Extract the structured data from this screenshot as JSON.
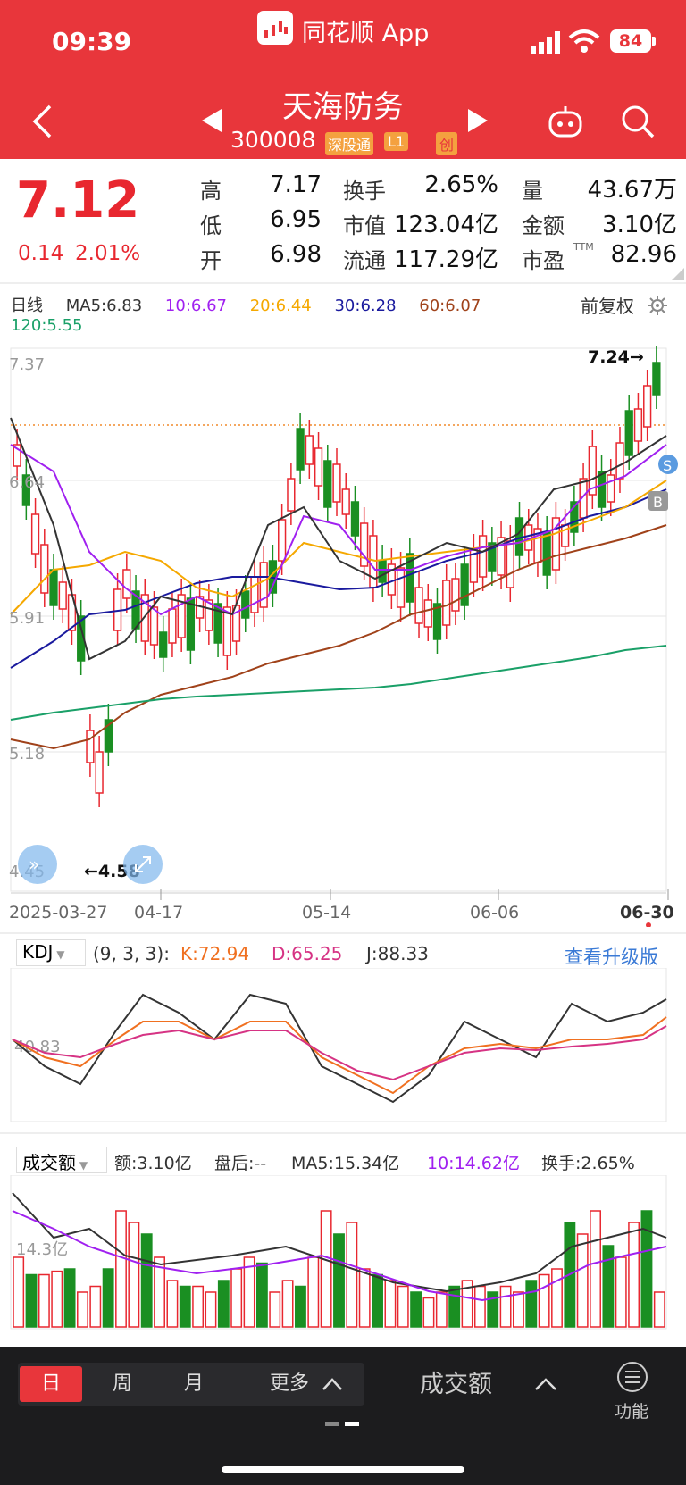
{
  "status": {
    "time": "09:39",
    "app_title": "同花顺 App",
    "battery": "84"
  },
  "stock": {
    "name": "天海防务",
    "code": "300008",
    "tag1": "深股通",
    "tag2": "L1",
    "tag3": "创"
  },
  "quote": {
    "price": "7.12",
    "change": "0.14",
    "pct": "2.01%",
    "high_label": "高",
    "high": "7.17",
    "low_label": "低",
    "low": "6.95",
    "open_label": "开",
    "open": "6.98",
    "turnover_label": "换手",
    "turnover": "2.65%",
    "mcap_label": "市值",
    "mcap": "123.04亿",
    "float_label": "流通",
    "float": "117.29亿",
    "vol_label": "量",
    "vol": "43.67万",
    "amount_label": "金额",
    "amount": "3.10亿",
    "pe_label": "市盈",
    "pe_sup": "TTM",
    "pe": "82.96"
  },
  "ma": {
    "period": "日线",
    "ma5": "MA5:6.83",
    "ma10": "10:6.67",
    "ma20": "20:6.44",
    "ma30": "30:6.28",
    "ma60": "60:6.07",
    "ma120": "120:5.55",
    "adjust": "前复权"
  },
  "chart": {
    "y_labels": [
      "7.37",
      "6.64",
      "5.91",
      "5.18",
      "4.45"
    ],
    "max_label": "7.24→",
    "min_label": "←4.58",
    "x_labels": [
      "2025-03-27",
      "04-17",
      "05-14",
      "06-06",
      "06-30"
    ],
    "s_mark": "S",
    "b_mark": "B"
  },
  "kdj": {
    "name": "KDJ",
    "params": "(9, 3, 3):",
    "k": "K:72.94",
    "d": "D:65.25",
    "j": "J:88.33",
    "upgrade": "查看升级版",
    "level": "40.83"
  },
  "amt": {
    "name": "成交额",
    "amount": "额:3.10亿",
    "after": "盘后:--",
    "ma5": "MA5:15.34亿",
    "ma10": "10:14.62亿",
    "turnover": "换手:2.65%",
    "level": "14.3亿"
  },
  "bottom": {
    "day": "日",
    "week": "周",
    "month": "月",
    "more": "更多",
    "indicator": "成交额",
    "func": "功能"
  },
  "colors": {
    "header": "#e8363b",
    "up": "#e8272f",
    "down": "#1a8f22",
    "ma10": "#a020f0",
    "ma20": "#f5a800",
    "ma30": "#1a1a9e",
    "ma60": "#a0421a",
    "ma120": "#1aa068"
  }
}
